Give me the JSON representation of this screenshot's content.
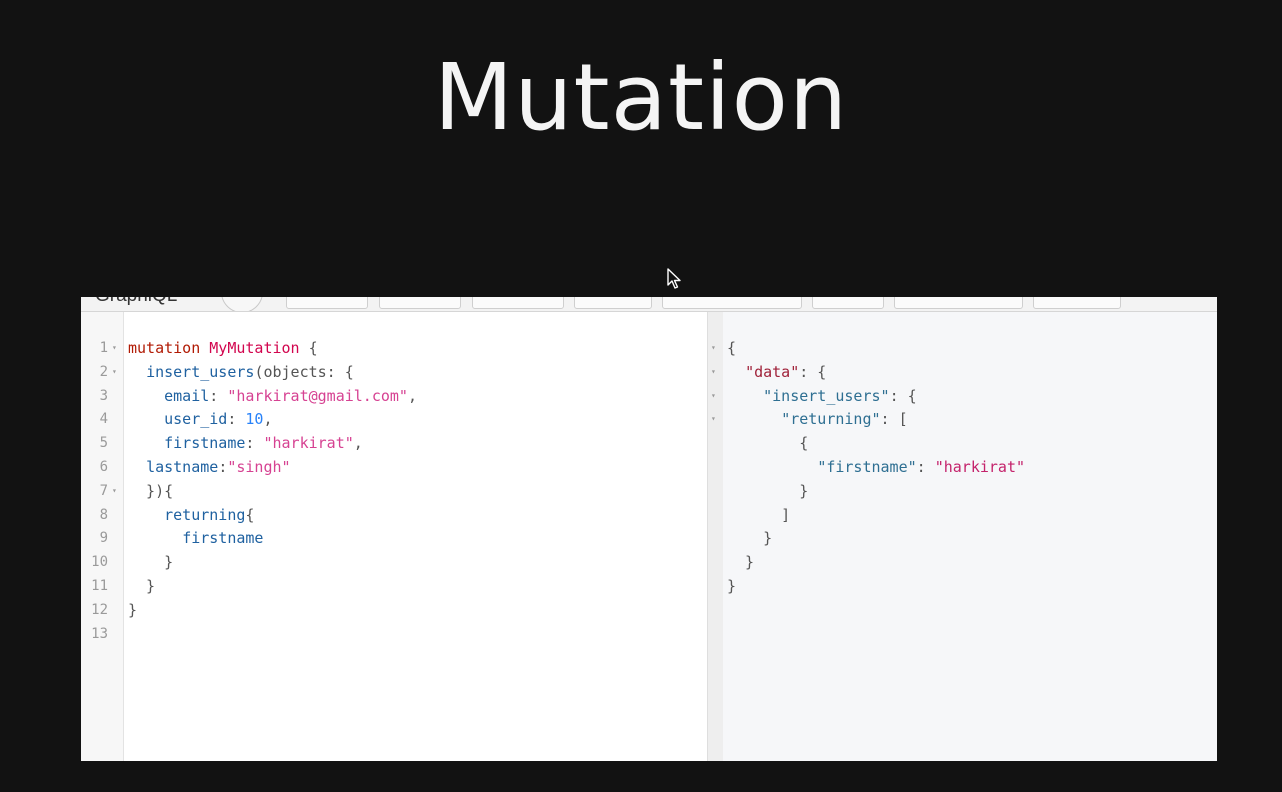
{
  "slide": {
    "title": "Mutation"
  },
  "app": {
    "name": "GraphiQL"
  },
  "editor": {
    "line_numbers": [
      "1",
      "2",
      "3",
      "4",
      "5",
      "6",
      "7",
      "8",
      "9",
      "10",
      "11",
      "12",
      "13"
    ],
    "lines": [
      {
        "fold": true,
        "tokens": [
          [
            "kw",
            "mutation"
          ],
          [
            "punc",
            " "
          ],
          [
            "def",
            "MyMutation"
          ],
          [
            "punc",
            " {"
          ]
        ]
      },
      {
        "fold": true,
        "tokens": [
          [
            "punc",
            "  "
          ],
          [
            "prop",
            "insert_users"
          ],
          [
            "punc",
            "(objects: {"
          ]
        ]
      },
      {
        "fold": false,
        "tokens": [
          [
            "punc",
            "    "
          ],
          [
            "prop",
            "email"
          ],
          [
            "punc",
            ": "
          ],
          [
            "str",
            "\"harkirat@gmail.com\""
          ],
          [
            "punc",
            ","
          ]
        ]
      },
      {
        "fold": false,
        "tokens": [
          [
            "punc",
            "    "
          ],
          [
            "prop",
            "user_id"
          ],
          [
            "punc",
            ": "
          ],
          [
            "num",
            "10"
          ],
          [
            "punc",
            ","
          ]
        ]
      },
      {
        "fold": false,
        "tokens": [
          [
            "punc",
            "    "
          ],
          [
            "prop",
            "firstname"
          ],
          [
            "punc",
            ": "
          ],
          [
            "str",
            "\"harkirat\""
          ],
          [
            "punc",
            ","
          ]
        ]
      },
      {
        "fold": false,
        "tokens": [
          [
            "punc",
            "  "
          ],
          [
            "prop",
            "lastname"
          ],
          [
            "punc",
            ":"
          ],
          [
            "str",
            "\"singh\""
          ]
        ]
      },
      {
        "fold": true,
        "tokens": [
          [
            "punc",
            "  }){"
          ]
        ]
      },
      {
        "fold": false,
        "tokens": [
          [
            "punc",
            "    "
          ],
          [
            "prop",
            "returning"
          ],
          [
            "punc",
            "{"
          ]
        ]
      },
      {
        "fold": false,
        "tokens": [
          [
            "punc",
            "      "
          ],
          [
            "prop",
            "firstname"
          ]
        ]
      },
      {
        "fold": false,
        "tokens": [
          [
            "punc",
            "    }"
          ]
        ]
      },
      {
        "fold": false,
        "tokens": [
          [
            "punc",
            "  }"
          ]
        ]
      },
      {
        "fold": false,
        "tokens": [
          [
            "punc",
            "}"
          ]
        ]
      },
      {
        "fold": false,
        "tokens": []
      }
    ]
  },
  "result": {
    "lines": [
      {
        "fold": true,
        "tokens": [
          [
            "punc",
            "{"
          ]
        ]
      },
      {
        "fold": true,
        "tokens": [
          [
            "punc",
            "  "
          ],
          [
            "jkey-root",
            "\"data\""
          ],
          [
            "punc",
            ": {"
          ]
        ]
      },
      {
        "fold": true,
        "tokens": [
          [
            "punc",
            "    "
          ],
          [
            "jkey",
            "\"insert_users\""
          ],
          [
            "punc",
            ": {"
          ]
        ]
      },
      {
        "fold": true,
        "tokens": [
          [
            "punc",
            "      "
          ],
          [
            "jkey",
            "\"returning\""
          ],
          [
            "punc",
            ": ["
          ]
        ]
      },
      {
        "fold": false,
        "tokens": [
          [
            "punc",
            "        {"
          ]
        ]
      },
      {
        "fold": false,
        "tokens": [
          [
            "punc",
            "          "
          ],
          [
            "jkey",
            "\"firstname\""
          ],
          [
            "punc",
            ": "
          ],
          [
            "jstr",
            "\"harkirat\""
          ]
        ]
      },
      {
        "fold": false,
        "tokens": [
          [
            "punc",
            "        }"
          ]
        ]
      },
      {
        "fold": false,
        "tokens": [
          [
            "punc",
            "      ]"
          ]
        ]
      },
      {
        "fold": false,
        "tokens": [
          [
            "punc",
            "    }"
          ]
        ]
      },
      {
        "fold": false,
        "tokens": [
          [
            "punc",
            "  }"
          ]
        ]
      },
      {
        "fold": false,
        "tokens": [
          [
            "punc",
            "}"
          ]
        ]
      }
    ]
  }
}
